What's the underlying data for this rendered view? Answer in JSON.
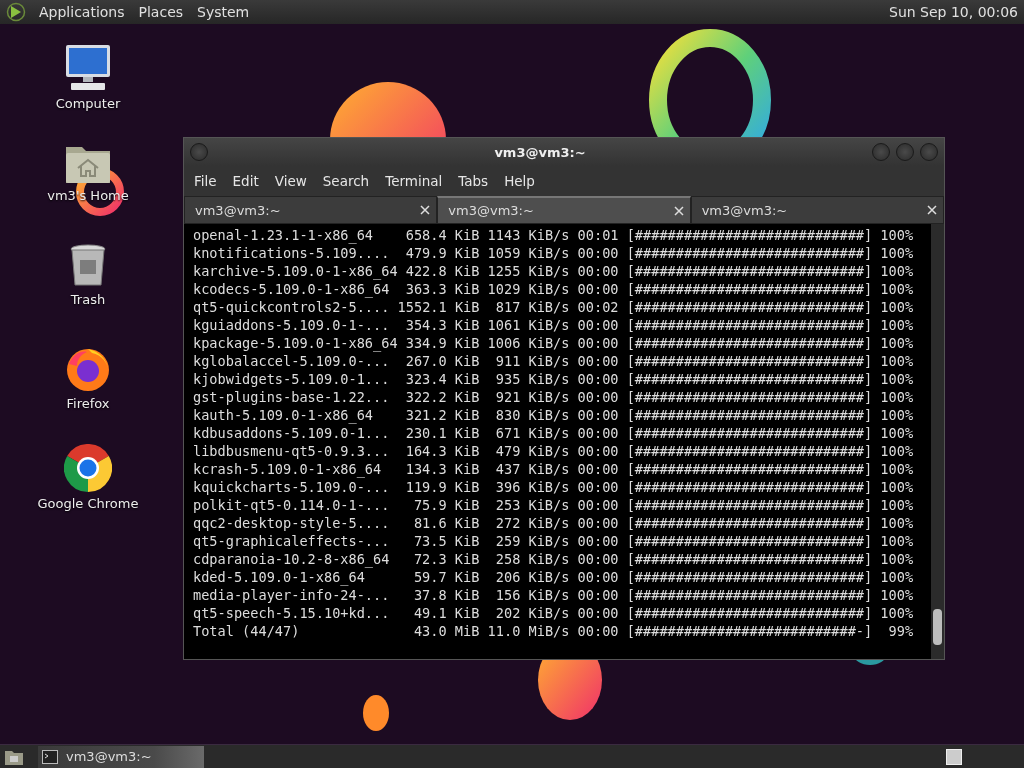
{
  "top_panel": {
    "menus": [
      {
        "label": "Applications"
      },
      {
        "label": "Places"
      },
      {
        "label": "System"
      }
    ],
    "clock": "Sun Sep 10, 00:06"
  },
  "desktop_icons": [
    {
      "label": "Computer",
      "kind": "computer"
    },
    {
      "label": "vm3's Home",
      "kind": "home"
    },
    {
      "label": "Trash",
      "kind": "trash"
    },
    {
      "label": "Firefox",
      "kind": "firefox"
    },
    {
      "label": "Google Chrome",
      "kind": "chrome"
    }
  ],
  "window": {
    "title": "vm3@vm3:~",
    "menu": [
      "File",
      "Edit",
      "View",
      "Search",
      "Terminal",
      "Tabs",
      "Help"
    ],
    "tabs": [
      {
        "label": "vm3@vm3:~",
        "selected": false
      },
      {
        "label": "vm3@vm3:~",
        "selected": true
      },
      {
        "label": "vm3@vm3:~",
        "selected": false
      }
    ],
    "terminal_lines": [
      {
        "name": "openal-1.23.1-1-x86_64",
        "size": "658.4 KiB",
        "speed": "1143 KiB/s",
        "time": "00:01",
        "bar": "[############################]",
        "percent": "100%"
      },
      {
        "name": "knotifications-5.109....",
        "size": "479.9 KiB",
        "speed": "1059 KiB/s",
        "time": "00:00",
        "bar": "[############################]",
        "percent": "100%"
      },
      {
        "name": "karchive-5.109.0-1-x86_64",
        "size": "422.8 KiB",
        "speed": "1255 KiB/s",
        "time": "00:00",
        "bar": "[############################]",
        "percent": "100%"
      },
      {
        "name": "kcodecs-5.109.0-1-x86_64",
        "size": "363.3 KiB",
        "speed": "1029 KiB/s",
        "time": "00:00",
        "bar": "[############################]",
        "percent": "100%"
      },
      {
        "name": "qt5-quickcontrols2-5....",
        "size": "1552.1 KiB",
        "speed": "817 KiB/s",
        "time": "00:02",
        "bar": "[############################]",
        "percent": "100%"
      },
      {
        "name": "kguiaddons-5.109.0-1-...",
        "size": "354.3 KiB",
        "speed": "1061 KiB/s",
        "time": "00:00",
        "bar": "[############################]",
        "percent": "100%"
      },
      {
        "name": "kpackage-5.109.0-1-x86_64",
        "size": "334.9 KiB",
        "speed": "1006 KiB/s",
        "time": "00:00",
        "bar": "[############################]",
        "percent": "100%"
      },
      {
        "name": "kglobalaccel-5.109.0-...",
        "size": "267.0 KiB",
        "speed": "911 KiB/s",
        "time": "00:00",
        "bar": "[############################]",
        "percent": "100%"
      },
      {
        "name": "kjobwidgets-5.109.0-1...",
        "size": "323.4 KiB",
        "speed": "935 KiB/s",
        "time": "00:00",
        "bar": "[############################]",
        "percent": "100%"
      },
      {
        "name": "gst-plugins-base-1.22...",
        "size": "322.2 KiB",
        "speed": "921 KiB/s",
        "time": "00:00",
        "bar": "[############################]",
        "percent": "100%"
      },
      {
        "name": "kauth-5.109.0-1-x86_64",
        "size": "321.2 KiB",
        "speed": "830 KiB/s",
        "time": "00:00",
        "bar": "[############################]",
        "percent": "100%"
      },
      {
        "name": "kdbusaddons-5.109.0-1...",
        "size": "230.1 KiB",
        "speed": "671 KiB/s",
        "time": "00:00",
        "bar": "[############################]",
        "percent": "100%"
      },
      {
        "name": "libdbusmenu-qt5-0.9.3...",
        "size": "164.3 KiB",
        "speed": "479 KiB/s",
        "time": "00:00",
        "bar": "[############################]",
        "percent": "100%"
      },
      {
        "name": "kcrash-5.109.0-1-x86_64",
        "size": "134.3 KiB",
        "speed": "437 KiB/s",
        "time": "00:00",
        "bar": "[############################]",
        "percent": "100%"
      },
      {
        "name": "kquickcharts-5.109.0-...",
        "size": "119.9 KiB",
        "speed": "396 KiB/s",
        "time": "00:00",
        "bar": "[############################]",
        "percent": "100%"
      },
      {
        "name": "polkit-qt5-0.114.0-1-...",
        "size": "75.9 KiB",
        "speed": "253 KiB/s",
        "time": "00:00",
        "bar": "[############################]",
        "percent": "100%"
      },
      {
        "name": "qqc2-desktop-style-5....",
        "size": "81.6 KiB",
        "speed": "272 KiB/s",
        "time": "00:00",
        "bar": "[############################]",
        "percent": "100%"
      },
      {
        "name": "qt5-graphicaleffects-...",
        "size": "73.5 KiB",
        "speed": "259 KiB/s",
        "time": "00:00",
        "bar": "[############################]",
        "percent": "100%"
      },
      {
        "name": "cdparanoia-10.2-8-x86_64",
        "size": "72.3 KiB",
        "speed": "258 KiB/s",
        "time": "00:00",
        "bar": "[############################]",
        "percent": "100%"
      },
      {
        "name": "kded-5.109.0-1-x86_64",
        "size": "59.7 KiB",
        "speed": "206 KiB/s",
        "time": "00:00",
        "bar": "[############################]",
        "percent": "100%"
      },
      {
        "name": "media-player-info-24-...",
        "size": "37.8 KiB",
        "speed": "156 KiB/s",
        "time": "00:00",
        "bar": "[############################]",
        "percent": "100%"
      },
      {
        "name": "qt5-speech-5.15.10+kd...",
        "size": "49.1 KiB",
        "speed": "202 KiB/s",
        "time": "00:00",
        "bar": "[############################]",
        "percent": "100%"
      },
      {
        "name": "Total (44/47)",
        "size": "43.0 MiB",
        "speed": "11.0 MiB/s",
        "time": "00:00",
        "bar": "[###########################-]",
        "percent": "99%"
      }
    ]
  },
  "taskbar": {
    "tasks": [
      {
        "label": "vm3@vm3:~",
        "selected": true
      }
    ]
  }
}
